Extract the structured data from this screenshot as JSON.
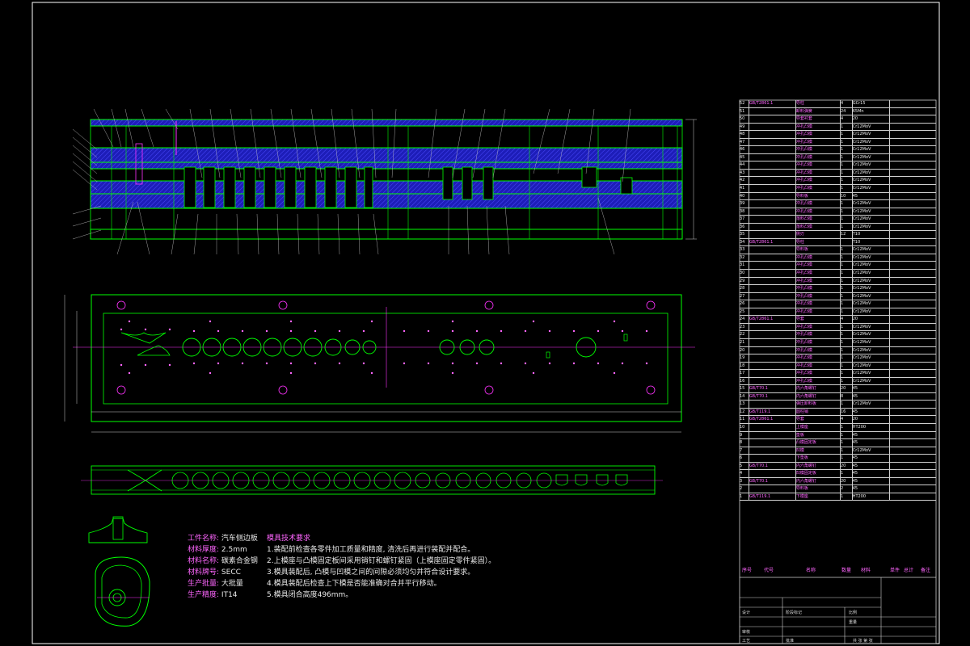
{
  "stock_properties": {
    "items": [
      {
        "key": "工件名称:",
        "value": "汽车侧边板"
      },
      {
        "key": "材料厚度:",
        "value": "2.5mm"
      },
      {
        "key": "材料名称:",
        "value": "碳素合金钢"
      },
      {
        "key": "材料牌号:",
        "value": "SECC"
      },
      {
        "key": "生产批量:",
        "value": "大批量"
      },
      {
        "key": "生产精度:",
        "value": "IT14"
      }
    ]
  },
  "tech_requirements": {
    "title": "模具技术要求",
    "items": [
      "1.装配前检查各零件加工质量和精度, 清洗后再进行装配并配合。",
      "2.上模座与凸模固定板间采用销钉和螺钉紧固（上模座固定零件紧固）。",
      "3.模具装配后, 凸模与凹模之间的间隙必须均匀并符合设计要求。",
      "4.模具装配后检查上下模是否能准确对合并平行移动。",
      "5.模具闭合高度496mm。"
    ]
  },
  "bom": {
    "header": [
      "序号",
      "代号",
      "名称",
      "数量",
      "材料",
      "单件",
      "总计",
      "备注"
    ],
    "rows": [
      {
        "no": "52",
        "code": "GB/T2861.1",
        "name": "导柱",
        "qty": "4",
        "mat": "GCr15"
      },
      {
        "no": "51",
        "code": "",
        "name": "卸料弹簧",
        "qty": "24",
        "mat": "65Mn"
      },
      {
        "no": "50",
        "code": "",
        "name": "导套衬套",
        "qty": "4",
        "mat": "20"
      },
      {
        "no": "49",
        "code": "",
        "name": "冲孔凸模",
        "qty": "1",
        "mat": "Cr12MoV"
      },
      {
        "no": "48",
        "code": "",
        "name": "冲孔凸模",
        "qty": "1",
        "mat": "Cr12MoV"
      },
      {
        "no": "47",
        "code": "",
        "name": "冲孔凸模",
        "qty": "1",
        "mat": "Cr12MoV"
      },
      {
        "no": "46",
        "code": "",
        "name": "冲孔凸模",
        "qty": "1",
        "mat": "Cr12MoV"
      },
      {
        "no": "45",
        "code": "",
        "name": "冲孔凸模",
        "qty": "1",
        "mat": "Cr12MoV"
      },
      {
        "no": "44",
        "code": "",
        "name": "冲孔凸模",
        "qty": "1",
        "mat": "Cr12MoV"
      },
      {
        "no": "43",
        "code": "",
        "name": "冲孔凸模",
        "qty": "1",
        "mat": "Cr12MoV"
      },
      {
        "no": "42",
        "code": "",
        "name": "冲孔凸模",
        "qty": "1",
        "mat": "Cr12MoV"
      },
      {
        "no": "41",
        "code": "",
        "name": "冲孔凸模",
        "qty": "1",
        "mat": "Cr12MoV"
      },
      {
        "no": "40",
        "code": "",
        "name": "导料板",
        "qty": "10",
        "mat": "45"
      },
      {
        "no": "39",
        "code": "",
        "name": "冲孔凸模",
        "qty": "1",
        "mat": "Cr12MoV"
      },
      {
        "no": "38",
        "code": "",
        "name": "冲孔凸模",
        "qty": "1",
        "mat": "Cr12MoV"
      },
      {
        "no": "37",
        "code": "",
        "name": "落料凸模",
        "qty": "1",
        "mat": "Cr12MoV"
      },
      {
        "no": "36",
        "code": "",
        "name": "落料凸模",
        "qty": "1",
        "mat": "Cr12MoV"
      },
      {
        "no": "35",
        "code": "",
        "name": "侧刃",
        "qty": "12",
        "mat": "T10"
      },
      {
        "no": "34",
        "code": "GB/T2861.1",
        "name": "导柱",
        "qty": "",
        "mat": "T10"
      },
      {
        "no": "33",
        "code": "",
        "name": "导料板",
        "qty": "1",
        "mat": "Cr12MoV"
      },
      {
        "no": "32",
        "code": "",
        "name": "冲孔凸模",
        "qty": "1",
        "mat": "Cr12MoV"
      },
      {
        "no": "31",
        "code": "",
        "name": "冲孔凸模",
        "qty": "1",
        "mat": "Cr12MoV"
      },
      {
        "no": "30",
        "code": "",
        "name": "冲孔凸模",
        "qty": "1",
        "mat": "Cr12MoV"
      },
      {
        "no": "29",
        "code": "",
        "name": "冲孔凸模",
        "qty": "1",
        "mat": "Cr12MoV"
      },
      {
        "no": "28",
        "code": "",
        "name": "冲孔凸模",
        "qty": "1",
        "mat": "Cr12MoV"
      },
      {
        "no": "27",
        "code": "",
        "name": "冲孔凸模",
        "qty": "1",
        "mat": "Cr12MoV"
      },
      {
        "no": "26",
        "code": "",
        "name": "冲孔凸模",
        "qty": "1",
        "mat": "Cr12MoV"
      },
      {
        "no": "25",
        "code": "",
        "name": "冲孔凸模",
        "qty": "1",
        "mat": "Cr12MoV"
      },
      {
        "no": "24",
        "code": "GB/T2861.1",
        "name": "导套",
        "qty": "4",
        "mat": "20"
      },
      {
        "no": "23",
        "code": "",
        "name": "冲孔凸模",
        "qty": "1",
        "mat": "Cr12MoV"
      },
      {
        "no": "22",
        "code": "",
        "name": "冲孔凸模",
        "qty": "1",
        "mat": "Cr12MoV"
      },
      {
        "no": "21",
        "code": "",
        "name": "冲孔凸模",
        "qty": "1",
        "mat": "Cr12MoV"
      },
      {
        "no": "20",
        "code": "",
        "name": "冲孔凸模",
        "qty": "1",
        "mat": "Cr12MoV"
      },
      {
        "no": "19",
        "code": "",
        "name": "冲孔凸模",
        "qty": "1",
        "mat": "Cr12MoV"
      },
      {
        "no": "18",
        "code": "",
        "name": "冲孔凸模",
        "qty": "1",
        "mat": "Cr12MoV"
      },
      {
        "no": "17",
        "code": "",
        "name": "冲孔凸模",
        "qty": "1",
        "mat": "Cr12MoV"
      },
      {
        "no": "16",
        "code": "",
        "name": "冲孔凸模",
        "qty": "1",
        "mat": "Cr12MoV"
      },
      {
        "no": "15",
        "code": "GB/T70.1",
        "name": "内六角螺钉",
        "qty": "20",
        "mat": "45"
      },
      {
        "no": "14",
        "code": "GB/T70.1",
        "name": "内六角螺钉",
        "qty": "8",
        "mat": "45"
      },
      {
        "no": "13",
        "code": "",
        "name": "弹压卸料板",
        "qty": "1",
        "mat": "Cr12MoV"
      },
      {
        "no": "12",
        "code": "GB/T119.1",
        "name": "圆柱销",
        "qty": "16",
        "mat": "45"
      },
      {
        "no": "11",
        "code": "GB/T2861.1",
        "name": "导套",
        "qty": "4",
        "mat": "20"
      },
      {
        "no": "10",
        "code": "",
        "name": "上模座",
        "qty": "1",
        "mat": "HT200"
      },
      {
        "no": "9",
        "code": "",
        "name": "垫板",
        "qty": "1",
        "mat": "45"
      },
      {
        "no": "8",
        "code": "",
        "name": "凸模固定板",
        "qty": "1",
        "mat": "45"
      },
      {
        "no": "7",
        "code": "",
        "name": "凹模",
        "qty": "1",
        "mat": "Cr12MoV"
      },
      {
        "no": "6",
        "code": "",
        "name": "下垫板",
        "qty": "1",
        "mat": "45"
      },
      {
        "no": "5",
        "code": "GB/T70.1",
        "name": "内六角螺钉",
        "qty": "20",
        "mat": "45"
      },
      {
        "no": "4",
        "code": "",
        "name": "凹模固定板",
        "qty": "1",
        "mat": "45"
      },
      {
        "no": "3",
        "code": "GB/T70.1",
        "name": "内六角螺钉",
        "qty": "20",
        "mat": "45"
      },
      {
        "no": "2",
        "code": "",
        "name": "导料板",
        "qty": "2",
        "mat": "45"
      },
      {
        "no": "1",
        "code": "GB/T119.1",
        "name": "下模座",
        "qty": "1",
        "mat": "HT200"
      }
    ]
  },
  "title_block": {
    "design": "设计",
    "check": "审核",
    "process": "工艺",
    "approve": "批准",
    "scale": "比例",
    "weight": "重量",
    "sheet": "共 张 第 张",
    "stage": "阶段标记"
  },
  "colors": {
    "outline": "#00ff00",
    "hatch": "#2323c8",
    "centerline": "#ff33ff",
    "dimension": "#cccccc",
    "frame": "#ffffff"
  }
}
